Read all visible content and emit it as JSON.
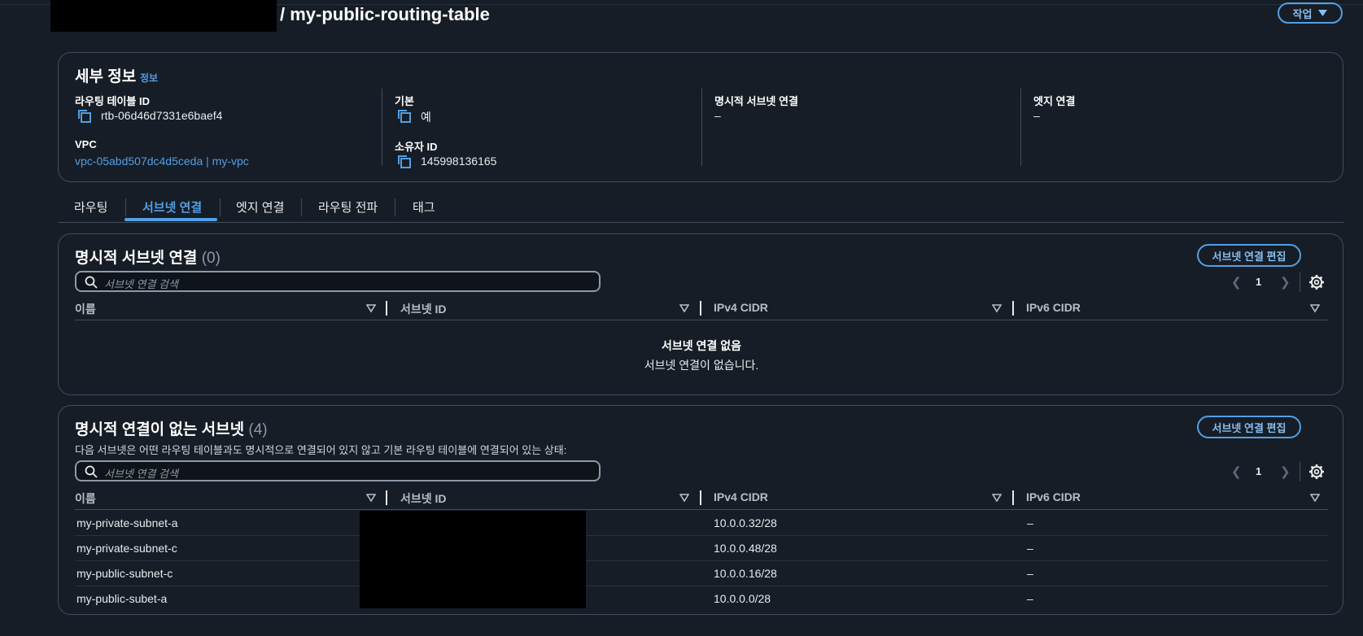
{
  "header": {
    "title": "/ my-public-routing-table",
    "action_label": "작업"
  },
  "details": {
    "heading": "세부 정보",
    "info_link": "정보",
    "route_table_id_label": "라우팅 테이블 ID",
    "route_table_id": "rtb-06d46d7331e6baef4",
    "main_label": "기본",
    "main_value": "예",
    "explicit_subnet_label": "명시적 서브넷 연결",
    "explicit_subnet_value": "–",
    "edge_label": "엣지 연결",
    "edge_value": "–",
    "vpc_label": "VPC",
    "vpc_value": "vpc-05abd507dc4d5ceda | my-vpc",
    "owner_label": "소유자 ID",
    "owner_value": "145998136165"
  },
  "tabs": [
    {
      "label": "라우팅"
    },
    {
      "label": "서브넷 연결"
    },
    {
      "label": "엣지 연결"
    },
    {
      "label": "라우팅 전파"
    },
    {
      "label": "태그"
    }
  ],
  "explicit_panel": {
    "heading": "명시적 서브넷 연결",
    "count": "(0)",
    "edit_button": "서브넷 연결 편집",
    "search_placeholder": "서브넷 연결 검색",
    "page": "1",
    "columns": [
      "이름",
      "서브넷 ID",
      "IPv4 CIDR",
      "IPv6 CIDR"
    ],
    "empty_title": "서브넷 연결 없음",
    "empty_subtitle": "서브넷 연결이 없습니다."
  },
  "implicit_panel": {
    "heading": "명시적 연결이 없는 서브넷",
    "count": "(4)",
    "description": "다음 서브넷은 어떤 라우팅 테이블과도 명시적으로 연결되어 있지 않고 기본 라우팅 테이블에 연결되어 있는 상태:",
    "edit_button": "서브넷 연결 편집",
    "search_placeholder": "서브넷 연결 검색",
    "page": "1",
    "columns": [
      "이름",
      "서브넷 ID",
      "IPv4 CIDR",
      "IPv6 CIDR"
    ],
    "rows": [
      {
        "name": "my-private-subnet-a",
        "ipv4": "10.0.0.32/28",
        "ipv6": "–"
      },
      {
        "name": "my-private-subnet-c",
        "ipv4": "10.0.0.48/28",
        "ipv6": "–"
      },
      {
        "name": "my-public-subnet-c",
        "ipv4": "10.0.0.16/28",
        "ipv6": "–"
      },
      {
        "name": "my-public-subet-a",
        "ipv4": "10.0.0.0/28",
        "ipv6": "–"
      }
    ]
  },
  "colors": {
    "background": "#161d26",
    "accent": "#539fe5",
    "border": "#414d5c"
  }
}
